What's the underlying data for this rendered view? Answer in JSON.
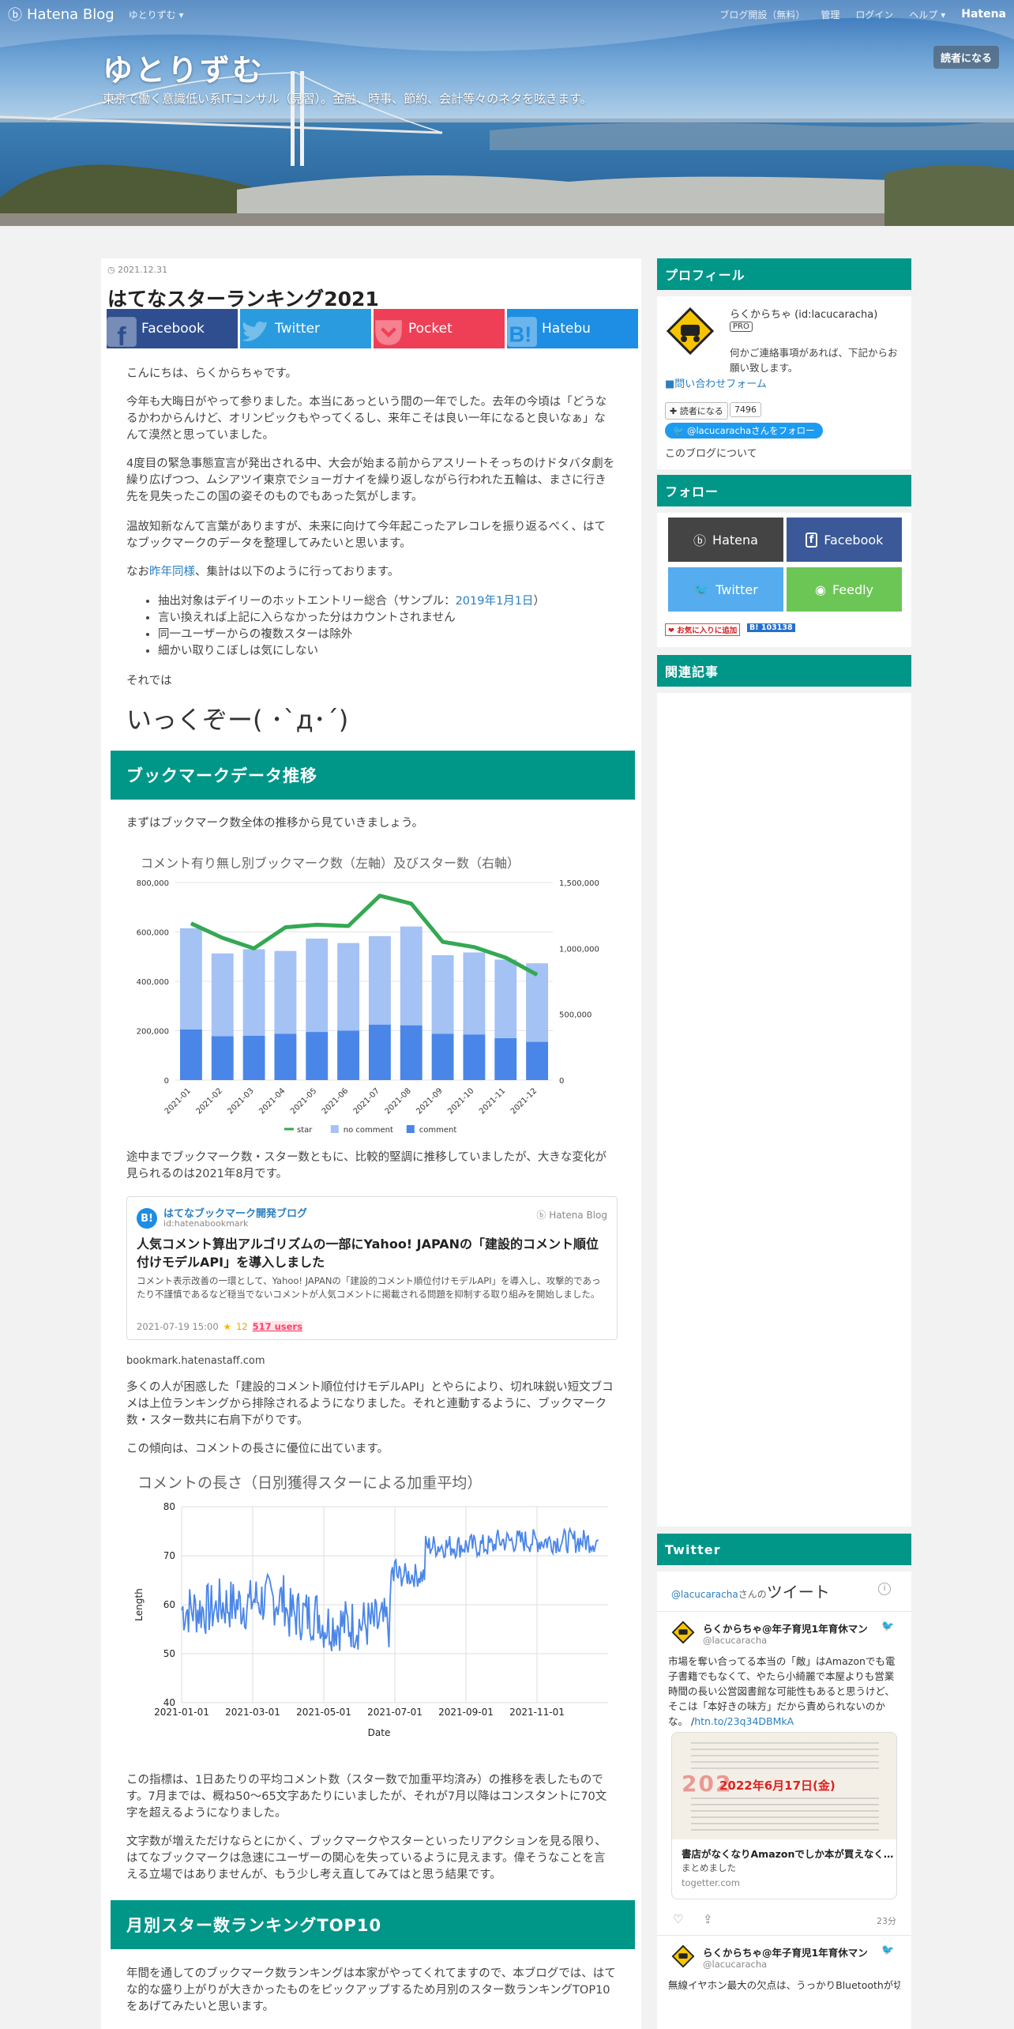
{
  "topbar": {
    "brand": "Hatena Blog",
    "menu": "ゆとりずむ ▾",
    "links": [
      "ブログ開設（無料）",
      "管理",
      "ログイン",
      "ヘルプ ▾"
    ],
    "brand_right": "Hatena"
  },
  "blog": {
    "title": "ゆとりずむ",
    "description": "東京で働く意識低い系ITコンサル（見習）。金融、時事、節約、会計等々のネタを呟きます。",
    "subscribe": "読者になる"
  },
  "entry": {
    "date": "2021.12.31",
    "title": "はてなスターランキング2021",
    "share": [
      {
        "label": "Facebook",
        "color": "#2e4e8f"
      },
      {
        "label": "Twitter",
        "color": "#2b9be0"
      },
      {
        "label": "Pocket",
        "color": "#ef3f56"
      },
      {
        "label": "Hatebu",
        "color": "#1d8ee3"
      }
    ],
    "p1": "こんにちは、らくからちゃです。",
    "p2": "今年も大晦日がやって参りました。本当にあっという間の一年でした。去年の今頃は「どうなるかわからんけど、オリンピックもやってくるし、来年こそは良い一年になると良いなぁ」なんて漠然と思っていました。",
    "p3": "4度目の緊急事態宣言が発出される中、大会が始まる前からアスリートそっちのけドタバタ劇を繰り広げつつ、ムシアツイ東京でショーガナイを繰り返しながら行われた五輪は、まさに行き先を見失ったこの国の姿そのものでもあった気がします。",
    "p4": "温故知新なんて言葉がありますが、未来に向けて今年起こったアレコレを振り返るべく、はてなブックマークのデータを整理してみたいと思います。",
    "p5_pre": "なお",
    "p5_link": "昨年同様",
    "p5_post": "、集計は以下のように行っております。",
    "list": [
      {
        "pre": "抽出対象はデイリーのホットエントリー総合（サンプル：",
        "link": "2019年1月1日",
        "post": "）"
      },
      {
        "pre": "言い換えれば上記に入らなかった分はカウントされません",
        "link": "",
        "post": ""
      },
      {
        "pre": "同一ユーザーからの複数スターは除外",
        "link": "",
        "post": ""
      },
      {
        "pre": "細かい取りこぼしは気にしない",
        "link": "",
        "post": ""
      }
    ],
    "then": "それでは",
    "big": "いっくぞー( ･`д･´)",
    "sec1": "ブックマークデータ推移",
    "p6": "まずはブックマーク数全体の推移から見ていきましょう。",
    "p7": "途中までブックマーク数・スター数ともに、比較的堅調に推移していましたが、大きな変化が見られるのは2021年8月です。",
    "embed": {
      "blog": "はてなブックマーク開発ブログ",
      "id": "id:hatenabookmark",
      "brand": "Hatena Blog",
      "title": "人気コメント算出アルゴリズムの一部にYahoo! JAPANの「建設的コメント順位付けモデルAPI」を導入しました",
      "desc": "コメント表示改善の一環として、Yahoo! JAPANの「建設的コメント順位付けモデルAPI」を導入し、攻撃的であったり不謹慎であるなど穏当でないコメントが人気コメントに掲載される問題を抑制する取り組みを開始しました。",
      "date": "2021-07-19 15:00",
      "stars": "12",
      "users": "517 users"
    },
    "embed_link": "bookmark.hatenastaff.com",
    "p8": "多くの人が困惑した「建設的コメント順位付けモデルAPI」とやらにより、切れ味鋭い短文ブコメは上位ランキングから排除されるようになりました。それと連動するように、ブックマーク数・スター数共に右肩下がりです。",
    "p9": "この傾向は、コメントの長さに優位に出ています。",
    "p10": "この指標は、1日あたりの平均コメント数（スター数で加重平均済み）の推移を表したものです。7月までは、概ね50〜65文字あたりにいましたが、それが7月以降はコンスタントに70文字を超えるようになりました。",
    "p11": "文字数が増えただけならとにかく、ブックマークやスターといったリアクションを見る限り、はてなブックマークは急速にユーザーの関心を失っているように見えます。偉そうなことを言える立場ではありませんが、もう少し考え直してみてはと思う結果です。",
    "sec2": "月別スター数ランキングTOP10",
    "p12": "年間を通してのブックマーク数ランキングは本家がやってくれてますので、本ブログでは、はてな的な盛り上がりが大きかったものをピックアップするため月別のスター数ランキングTOP10をあげてみたいと思います。"
  },
  "chart_data": [
    {
      "type": "bar",
      "title": "コメント有り無し別ブックマーク数（左軸）及びスター数（右軸）",
      "categories": [
        "2021-01",
        "2021-02",
        "2021-03",
        "2021-04",
        "2021-05",
        "2021-06",
        "2021-07",
        "2021-08",
        "2021-09",
        "2021-10",
        "2021-11",
        "2021-12"
      ],
      "series": [
        {
          "name": "comment",
          "values": [
            205000,
            178000,
            180000,
            188000,
            195000,
            200000,
            225000,
            222000,
            188000,
            185000,
            170000,
            155000
          ],
          "color": "#4a86e8"
        },
        {
          "name": "no comment",
          "values": [
            410000,
            335000,
            350000,
            335000,
            378000,
            355000,
            358000,
            400000,
            318000,
            332000,
            318000,
            318000
          ],
          "color": "#a4c2f4"
        },
        {
          "name": "star",
          "values": [
            1190000,
            1080000,
            1000000,
            1160000,
            1180000,
            1170000,
            1400000,
            1340000,
            1050000,
            1010000,
            930000,
            800000
          ],
          "color": "#34a853"
        }
      ],
      "ylim": [
        0,
        800000
      ],
      "y2lim": [
        0,
        1500000
      ],
      "yticks": [
        "800,000",
        "600,000",
        "400,000",
        "200,000",
        "0"
      ],
      "y2ticks": [
        "1,500,000",
        "1,000,000",
        "500,000",
        "0"
      ],
      "legend": [
        "star",
        "no comment",
        "comment"
      ],
      "legend_position": "bottom"
    },
    {
      "type": "line",
      "title": "コメントの長さ（日別獲得スターによる加重平均）",
      "xlabel": "Date",
      "ylabel": "Length",
      "x_range": [
        "2021-01-01",
        "2021-12-31"
      ],
      "xticks": [
        "2021-01-01",
        "2021-03-01",
        "2021-05-01",
        "2021-07-01",
        "2021-09-01",
        "2021-11-01"
      ],
      "yticks": [
        "80",
        "70",
        "60",
        "50",
        "40"
      ],
      "ylim": [
        40,
        80
      ],
      "series": [
        {
          "name": "",
          "color": "#4a86e8",
          "x_step": "monthly",
          "x": [
            "2021-01",
            "2021-02",
            "2021-03",
            "2021-04",
            "2021-05",
            "2021-06",
            "2021-07",
            "2021-08",
            "2021-09",
            "2021-10",
            "2021-11",
            "2021-12"
          ],
          "values": [
            59,
            60,
            61,
            58,
            56,
            56,
            66,
            72,
            72,
            73,
            73,
            73
          ]
        }
      ]
    }
  ],
  "sidebar": {
    "profile_title": "プロフィール",
    "name": "らくからちゃ (id:lacucaracha)",
    "pro": "PRO",
    "contact": "何かご連絡事項があれば、下記からお願い致します。",
    "contact_link": "■問い合わせフォーム",
    "reader_btn": "読者になる",
    "reader_count": "7496",
    "follow_tw": "@lacucarachaさんをフォロー",
    "about": "このブログについて",
    "follow_title": "フォロー",
    "follow": [
      {
        "label": "Hatena",
        "color": "#444"
      },
      {
        "label": "Facebook",
        "color": "#3b5998"
      },
      {
        "label": "Twitter",
        "color": "#55acee"
      },
      {
        "label": "Feedly",
        "color": "#6cc655"
      }
    ],
    "fav": "お気に入りに追加",
    "hatebu_count": "103138",
    "related_title": "関連記事",
    "twitter_title": "Twitter",
    "tw_head_user": "@lacucaracha",
    "tw_head_mid": "さんの",
    "tw_head_tail": "ツイート",
    "tweets": [
      {
        "name": "らくからちゃ@年子育児1年育休マン",
        "handle": "@lacucaracha",
        "text": "市場を奪い合ってる本当の「敵」はAmazonでも電子書籍でもなくて、やたら小綺麗で本屋よりも営業時間の長い公営図書館な可能性もあると思うけど、そこは「本好きの味方」だから責められないのかな。 /",
        "link": "htn.to/23q34DBMkA",
        "card_title": "書店がなくなりAmazonでしか本が買えなく…",
        "card_sub": "まとめました",
        "card_url": "togetter.com",
        "card_img_date": "2022年6月17日(金)",
        "time": "23分"
      },
      {
        "name": "らくからちゃ@年子育児1年育休マン",
        "handle": "@lacucaracha",
        "text": "無線イヤホン最大の欠点は、うっかりBluetoothが切"
      }
    ]
  }
}
